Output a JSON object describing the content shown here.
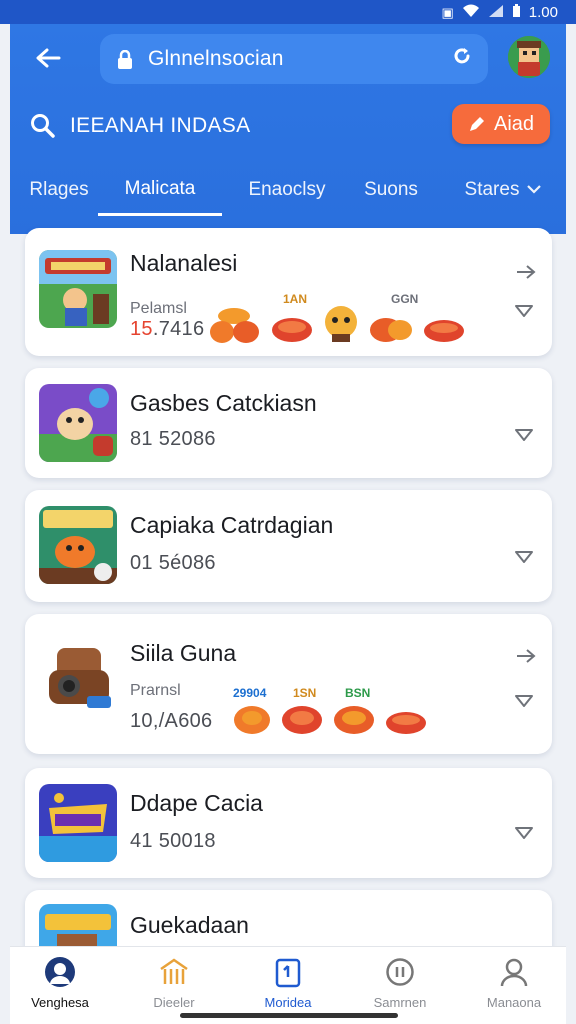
{
  "status_bar": {
    "time": "1.00"
  },
  "header": {
    "url": "Glnnelnsocian",
    "search_text": "IEEANAH INDASA",
    "add_label": "Aiad",
    "tabs": [
      "Rlages",
      "Malicata",
      "Enaoclsy",
      "Suons",
      "Stares"
    ]
  },
  "cards": [
    {
      "title": "Nalanalesi",
      "sub_label": "Pelamsl",
      "value_hl": "15",
      "value_rest": ".7416",
      "chip_labels": [
        "1AN",
        "GGN"
      ]
    },
    {
      "title": "Gasbes Catckiasn",
      "value": "81 52086"
    },
    {
      "title": "Capiaka Catrdagian",
      "value": "01 5é086"
    },
    {
      "title": "Siila Guna",
      "sub_label": "Prarnsl",
      "value": "10,/A606",
      "chip_labels": [
        "29904",
        "1SN",
        "BSN"
      ]
    },
    {
      "title": "Ddape Cacia",
      "value": "41 50018"
    },
    {
      "title": "Guekadaan"
    }
  ],
  "bottom_nav": [
    "Venghesa",
    "Dieeler",
    "Moridea",
    "Samrnen",
    "Manaona"
  ],
  "colors": {
    "primary": "#2a6fdd",
    "accent": "#f66b3c",
    "status": "#1f56c7"
  }
}
